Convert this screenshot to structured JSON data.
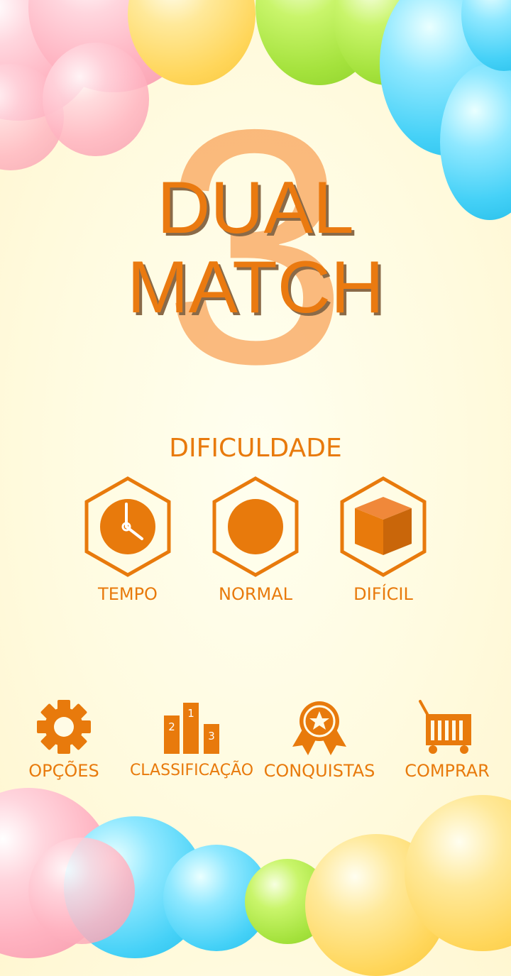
{
  "logo": {
    "number": "3",
    "line1": "DUAL",
    "line2": "MATCH"
  },
  "difficulty": {
    "heading": "DIFICULDADE",
    "modes": [
      {
        "label": "TEMPO",
        "icon": "clock-icon"
      },
      {
        "label": "NORMAL",
        "icon": "circle-icon"
      },
      {
        "label": "DIFÍCIL",
        "icon": "cube-icon"
      }
    ]
  },
  "menu": {
    "options": {
      "label": "OPÇÕES",
      "icon": "gear-icon"
    },
    "leaderboard": {
      "label": "CLASSIFICAÇÃO",
      "icon": "podium-icon",
      "podium": [
        "2",
        "1",
        "3"
      ]
    },
    "achievements": {
      "label": "CONQUISTAS",
      "icon": "medal-icon"
    },
    "shop": {
      "label": "COMPRAR",
      "icon": "cart-icon"
    }
  },
  "colors": {
    "accent": "#e87a0c",
    "background": "#fffbe0"
  }
}
